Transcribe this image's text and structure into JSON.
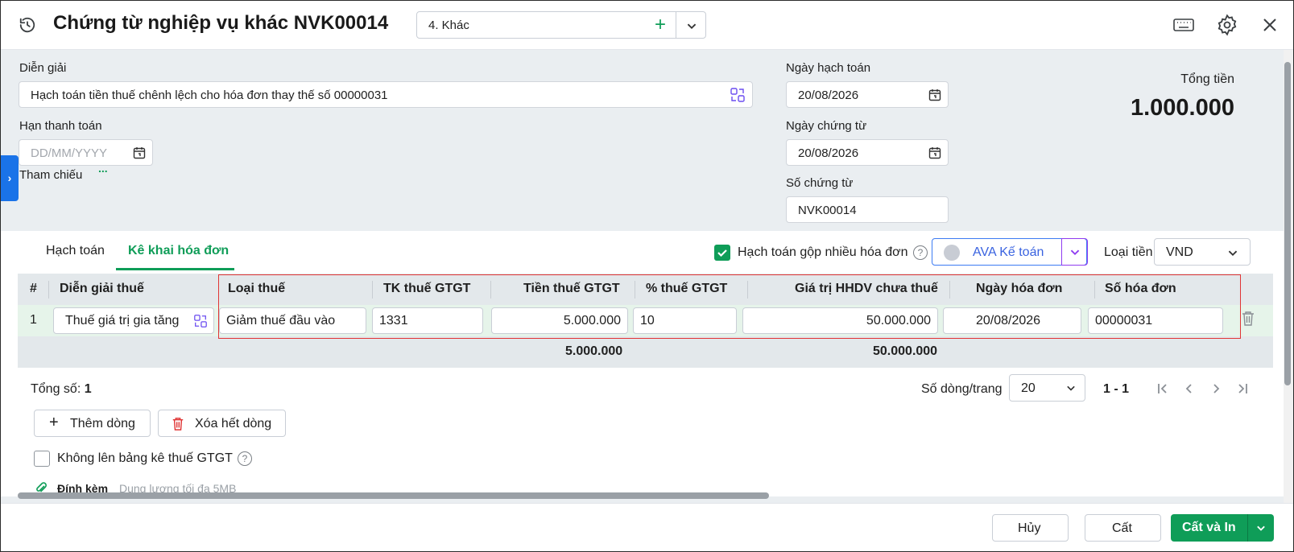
{
  "header": {
    "title": "Chứng từ nghiệp vụ khác NVK00014",
    "type_value": "4. Khác"
  },
  "form": {
    "dien_giai_label": "Diễn giải",
    "dien_giai_value": "Hạch toán tiền thuế chênh lệch cho hóa đơn thay thế số 00000031",
    "han_thanh_toan_label": "Hạn thanh toán",
    "han_thanh_toan_placeholder": "DD/MM/YYYY",
    "tham_chieu_label": "Tham chiếu",
    "tham_chieu_more": "...",
    "ngay_hach_toan_label": "Ngày hạch toán",
    "ngay_hach_toan_value": "20/08/2026",
    "ngay_chung_tu_label": "Ngày chứng từ",
    "ngay_chung_tu_value": "20/08/2026",
    "so_chung_tu_label": "Số chứng từ",
    "so_chung_tu_value": "NVK00014",
    "tong_tien_label": "Tổng tiền",
    "tong_tien_value": "1.000.000"
  },
  "tabs": [
    {
      "label": "Hạch toán",
      "active": false
    },
    {
      "label": "Kê khai hóa đơn",
      "active": true
    }
  ],
  "toolbar": {
    "gop_hoa_don_label": "Hạch toán gộp nhiều hóa đơn",
    "gop_hoa_don_checked": true,
    "ava_label": "AVA Kế toán",
    "loai_tien_label": "Loại tiền",
    "loai_tien_value": "VND"
  },
  "grid": {
    "columns": [
      "#",
      "Diễn giải thuế",
      "Loại thuế",
      "TK thuế GTGT",
      "Tiền thuế GTGT",
      "% thuế GTGT",
      "Giá trị HHDV chưa thuế",
      "Ngày hóa đơn",
      "Số hóa đơn"
    ],
    "rows": [
      {
        "no": "1",
        "dien_giai_thue": "Thuế giá trị gia tăng",
        "loai_thue": "Giảm thuế đầu vào",
        "tk_thue": "1331",
        "tien_thue": "5.000.000",
        "phan_tram": "10",
        "gia_tri": "50.000.000",
        "ngay_hd": "20/08/2026",
        "so_hd": "00000031"
      }
    ],
    "totals": {
      "tien_thue": "5.000.000",
      "gia_tri": "50.000.000"
    }
  },
  "pager": {
    "total_label": "Tổng số:",
    "total_value": "1",
    "rows_per_page_label": "Số dòng/trang",
    "rows_per_page_value": "20",
    "range": "1 - 1"
  },
  "actions": {
    "add_row": "Thêm dòng",
    "delete_all": "Xóa hết dòng",
    "khong_len_bang_ke": "Không lên bảng kê thuế GTGT",
    "dinh_kem": "Đính kèm",
    "dinh_kem_hint": "Dung lượng tối đa 5MB"
  },
  "footer": {
    "cancel": "Hủy",
    "save": "Cất",
    "save_print": "Cất và In"
  },
  "colors": {
    "accent": "#0f9d58",
    "primary_blue": "#1a73e8",
    "highlight_red": "#e03535"
  }
}
